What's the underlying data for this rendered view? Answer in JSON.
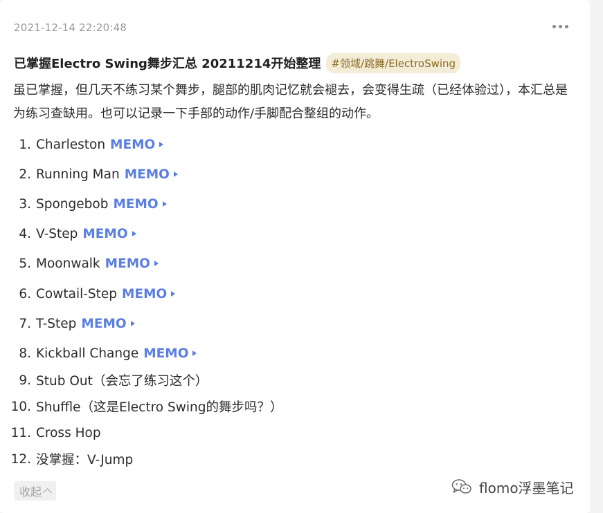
{
  "memo": {
    "timestamp": "2021-12-14 22:20:48",
    "title": "已掌握Electro Swing舞步汇总 20211214开始整理",
    "tag": "#领域/跳舞/ElectroSwing",
    "description": "虽已掌握，但几天不练习某个舞步，腿部的肌肉记忆就会褪去，会变得生疏（已经体验过），本汇总是为练习查缺用。也可以记录一下手部的动作/手脚配合整组的动作。",
    "memo_label": "MEMO",
    "items": [
      {
        "num": "1.",
        "text": "Charleston",
        "has_memo": true
      },
      {
        "num": "2.",
        "text": "Running Man",
        "has_memo": true
      },
      {
        "num": "3.",
        "text": "Spongebob",
        "has_memo": true
      },
      {
        "num": "4.",
        "text": "V-Step",
        "has_memo": true
      },
      {
        "num": "5.",
        "text": "Moonwalk",
        "has_memo": true
      },
      {
        "num": "6.",
        "text": "Cowtail-Step",
        "has_memo": true
      },
      {
        "num": "7.",
        "text": "T-Step",
        "has_memo": true
      },
      {
        "num": "8.",
        "text": "Kickball Change",
        "has_memo": true
      },
      {
        "num": "9.",
        "text": "Stub Out（会忘了练习这个）",
        "has_memo": false
      },
      {
        "num": "10.",
        "text": "Shuffle（这是Electro Swing的舞步吗？）",
        "has_memo": false
      },
      {
        "num": "11.",
        "text": "Cross Hop",
        "has_memo": false
      },
      {
        "num": "12.",
        "text": "没掌握：V-Jump",
        "has_memo": false
      }
    ],
    "collapse_label": "收起"
  },
  "watermark": {
    "icon": "wechat-icon",
    "text": "flomo浮墨笔记"
  },
  "colors": {
    "memo_link": "#5a7fe0",
    "tag_bg": "#f3ecd7",
    "tag_text": "#8a6a22",
    "muted": "#9a9a9a"
  }
}
